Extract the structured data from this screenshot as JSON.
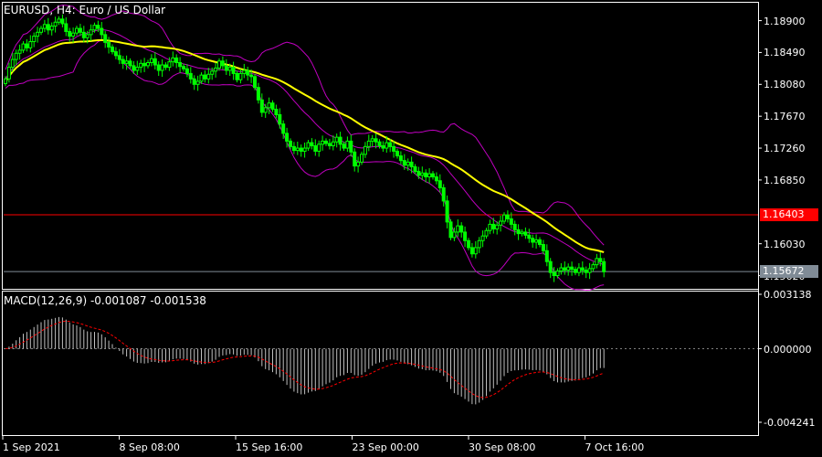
{
  "header": {
    "symbol_line": "EURUSD, H4:  Euro / US Dollar"
  },
  "indicator": {
    "title": "MACD(12,26,9) -0.001087 -0.001538"
  },
  "price_axis": {
    "ticks": [
      "1.18900",
      "1.18490",
      "1.18080",
      "1.17670",
      "1.17260",
      "1.16850",
      "1.16030",
      "1.15620"
    ],
    "min": 1.1545,
    "max": 1.1913
  },
  "macd_axis": {
    "ticks": [
      "0.003138",
      "0.000000",
      "-0.004241"
    ],
    "max": 0.003138,
    "min": -0.004241
  },
  "price_tags": {
    "red_line": {
      "text": "1.16403",
      "price": 1.16403,
      "color": "#ff0000"
    },
    "grey_line": {
      "text": "1.15672",
      "price": 1.15672,
      "color": "#808b96"
    }
  },
  "time_axis": {
    "labels": [
      "1 Sep 2021",
      "8 Sep 08:00",
      "15 Sep 16:00",
      "23 Sep 00:00",
      "30 Sep 08:00",
      "7 Oct 16:00"
    ]
  },
  "colors": {
    "background": "#000000",
    "candle": "#00ff00",
    "moving_average": "#ffff00",
    "bollinger": "#c000c0",
    "macd_histogram": "#c0c0c0",
    "macd_signal": "#ff0000",
    "axis": "#ffffff"
  },
  "chart_data": [
    {
      "type": "candlestick",
      "symbol": "EURUSD",
      "timeframe": "H4",
      "ylim": [
        1.1545,
        1.1913
      ],
      "close": [
        1.1815,
        1.183,
        1.184,
        1.1848,
        1.1852,
        1.186,
        1.1855,
        1.1863,
        1.187,
        1.1875,
        1.188,
        1.1885,
        1.1878,
        1.1883,
        1.1888,
        1.1892,
        1.1886,
        1.1876,
        1.187,
        1.1874,
        1.188,
        1.1875,
        1.1868,
        1.1872,
        1.1878,
        1.1884,
        1.188,
        1.1872,
        1.1862,
        1.1856,
        1.185,
        1.1845,
        1.184,
        1.1835,
        1.1838,
        1.1832,
        1.1826,
        1.183,
        1.1835,
        1.1832,
        1.1836,
        1.1841,
        1.1833,
        1.1826,
        1.1833,
        1.183,
        1.1837,
        1.1842,
        1.1836,
        1.1831,
        1.1828,
        1.1822,
        1.1815,
        1.1808,
        1.1812,
        1.182,
        1.1815,
        1.1821,
        1.1825,
        1.1829,
        1.1838,
        1.1832,
        1.1826,
        1.183,
        1.1822,
        1.1814,
        1.1822,
        1.1826,
        1.182,
        1.1818,
        1.1804,
        1.1788,
        1.1772,
        1.1778,
        1.1784,
        1.1776,
        1.1769,
        1.1757,
        1.1745,
        1.1735,
        1.1728,
        1.1723,
        1.1726,
        1.1722,
        1.1726,
        1.1733,
        1.1729,
        1.1722,
        1.1731,
        1.1735,
        1.1732,
        1.1729,
        1.1734,
        1.174,
        1.1731,
        1.1726,
        1.1735,
        1.1721,
        1.1703,
        1.1708,
        1.1718,
        1.1728,
        1.1735,
        1.1738,
        1.1734,
        1.1729,
        1.1726,
        1.1733,
        1.1728,
        1.1722,
        1.1716,
        1.171,
        1.1704,
        1.1708,
        1.1702,
        1.1696,
        1.1691,
        1.1694,
        1.1689,
        1.1693,
        1.1689,
        1.1684,
        1.1675,
        1.1658,
        1.1631,
        1.1611,
        1.1618,
        1.1626,
        1.1618,
        1.1607,
        1.1598,
        1.159,
        1.1598,
        1.1607,
        1.1613,
        1.162,
        1.1628,
        1.1622,
        1.1627,
        1.1632,
        1.164,
        1.1635,
        1.1628,
        1.1621,
        1.1616,
        1.1618,
        1.1614,
        1.161,
        1.1605,
        1.1608,
        1.1602,
        1.1594,
        1.158,
        1.1566,
        1.1562,
        1.1568,
        1.1572,
        1.1569,
        1.1573,
        1.157,
        1.1566,
        1.1572,
        1.1569,
        1.1566,
        1.1571,
        1.1576,
        1.1584,
        1.158,
        1.1567
      ]
    },
    {
      "type": "line",
      "name": "MACD(12,26,9)",
      "macd_main": -0.001087,
      "macd_signal": -0.001538,
      "ylim": [
        -0.004241,
        0.003138
      ]
    }
  ]
}
